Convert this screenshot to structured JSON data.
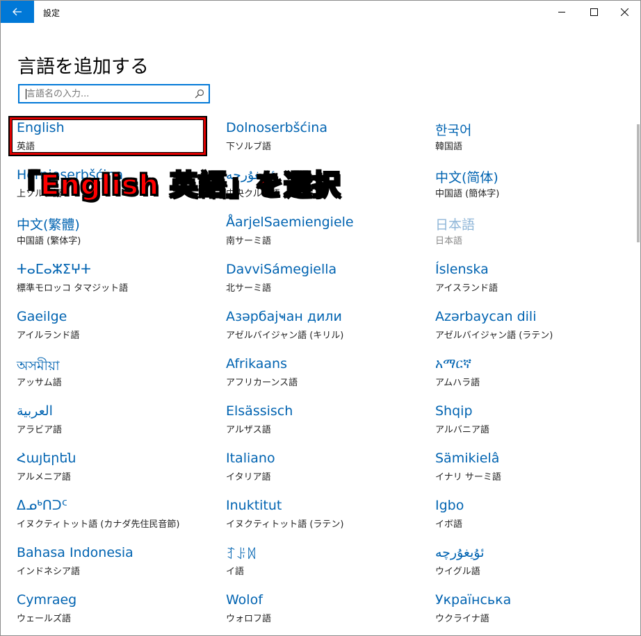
{
  "window": {
    "title": "設定"
  },
  "page": {
    "title": "言語を追加する"
  },
  "search": {
    "placeholder": "言語名の入力..."
  },
  "annotation": {
    "text": "「English 英語」を選択"
  },
  "languages": [
    {
      "name": "English",
      "sub": "英語"
    },
    {
      "name": "Dolnoserbšćina",
      "sub": "下ソルブ語"
    },
    {
      "name": "한국어",
      "sub": "韓国語"
    },
    {
      "name": "Hornjoserbšćina",
      "sub": "上ソルブ語"
    },
    {
      "name": "ئۇيغۇرچە",
      "sub": "中央クルド語"
    },
    {
      "name": "中文(简体)",
      "sub": "中国語 (簡体字)"
    },
    {
      "name": "中文(繁體)",
      "sub": "中国語 (繁体字)"
    },
    {
      "name": "ÅarjelSaemiengiele",
      "sub": "南サーミ語"
    },
    {
      "name": "日本語",
      "sub": "日本語",
      "disabled": true
    },
    {
      "name": "ⵜⴰⵎⴰⵣⵉⵖⵜ",
      "sub": "標準モロッコ タマジット語"
    },
    {
      "name": "DavviSámegiella",
      "sub": "北サーミ語"
    },
    {
      "name": "Íslenska",
      "sub": "アイスランド語"
    },
    {
      "name": "Gaeilge",
      "sub": "アイルランド語"
    },
    {
      "name": "Азәрбајҹан дили",
      "sub": "アゼルバイジャン語 (キリル)"
    },
    {
      "name": "Azərbaycan dili",
      "sub": "アゼルバイジャン語 (ラテン)"
    },
    {
      "name": "অসমীয়া",
      "sub": "アッサム語"
    },
    {
      "name": "Afrikaans",
      "sub": "アフリカーンス語"
    },
    {
      "name": "አማርኛ",
      "sub": "アムハラ語"
    },
    {
      "name": "العربية",
      "sub": "アラビア語"
    },
    {
      "name": "Elsässisch",
      "sub": "アルザス語"
    },
    {
      "name": "Shqip",
      "sub": "アルバニア語"
    },
    {
      "name": "Հայերեն",
      "sub": "アルメニア語"
    },
    {
      "name": "Italiano",
      "sub": "イタリア語"
    },
    {
      "name": "Sämikielâ",
      "sub": "イナリ サーミ語"
    },
    {
      "name": "ᐃᓄᒃᑎᑐᑦ",
      "sub": "イヌクティトット語 (カナダ先住民音節)"
    },
    {
      "name": "Inuktitut",
      "sub": "イヌクティトット語 (ラテン)"
    },
    {
      "name": "Igbo",
      "sub": "イボ語"
    },
    {
      "name": "Bahasa Indonesia",
      "sub": "インドネシア語"
    },
    {
      "name": "ꆈꌠꉙ",
      "sub": "イ語"
    },
    {
      "name": "ئۇيغۇرچە",
      "sub": "ウイグル語"
    },
    {
      "name": "Cymraeg",
      "sub": "ウェールズ語"
    },
    {
      "name": "Wolof",
      "sub": "ウォロフ語"
    },
    {
      "name": "Українська",
      "sub": "ウクライナ語"
    }
  ]
}
